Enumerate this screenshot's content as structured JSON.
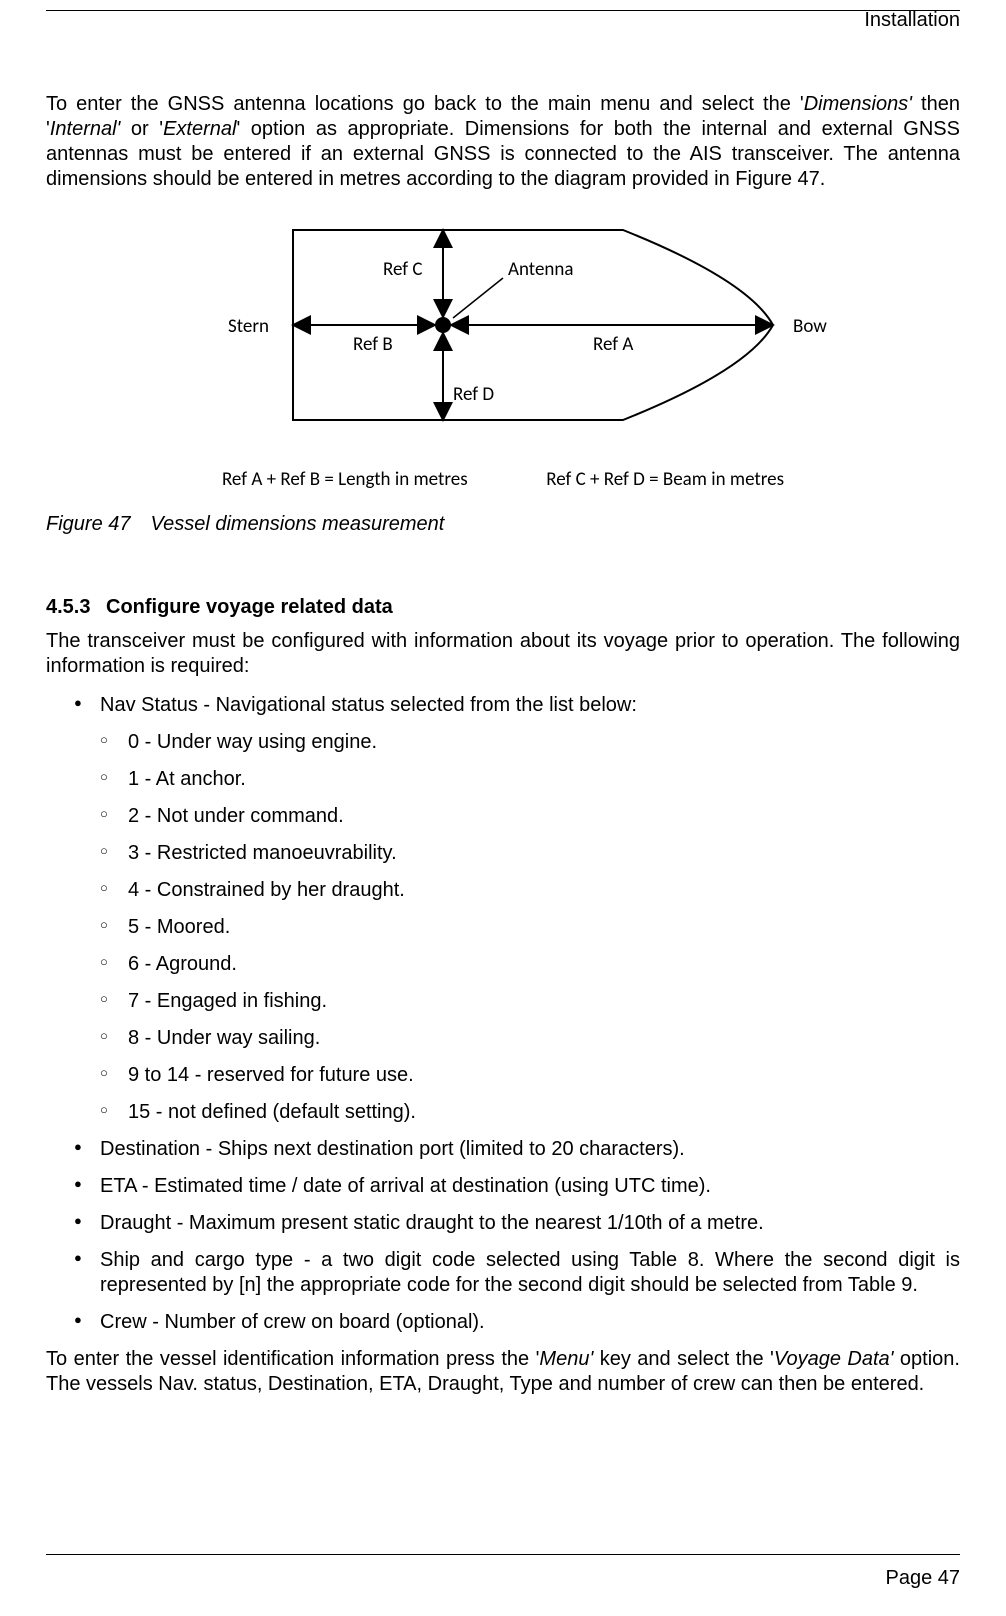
{
  "runningHead": "Installation",
  "pageNumber": "Page 47",
  "intro": {
    "part1": "To enter the GNSS antenna locations go back to the main menu and select the '",
    "dimWord": "Dimensions'",
    "part2": " then '",
    "intWord": "Internal'",
    "part3": " or '",
    "extWord": "External",
    "part4": "' option as appropriate. Dimensions for both the internal and external GNSS antennas must be entered if an external GNSS is connected to the AIS transceiver. The antenna dimensions should be entered in metres according to the diagram provided in Figure 47."
  },
  "figure": {
    "stern": "Stern",
    "bow": "Bow",
    "antenna": "Antenna",
    "refA": "Ref A",
    "refB": "Ref B",
    "refC": "Ref C",
    "refD": "Ref D",
    "eq1": "Ref A + Ref B = Length in metres",
    "eq2": "Ref C + Ref D = Beam in metres",
    "caption": "Figure 47 Vessel dimensions measurement"
  },
  "section": {
    "number": "4.5.3",
    "title": "Configure voyage related data",
    "lead": "The transceiver must be configured with information about its voyage prior to operation. The following information is required:"
  },
  "bullets": {
    "navStatus": "Nav Status - Navigational status selected from the list below:",
    "navItems": [
      "0 - Under way using engine.",
      "1 - At anchor.",
      "2 - Not under command.",
      "3 - Restricted manoeuvrability.",
      "4 - Constrained by her draught.",
      "5 - Moored.",
      "6 - Aground.",
      "7 - Engaged in fishing.",
      "8 - Under way sailing.",
      "9 to 14 - reserved for future use.",
      "15 - not defined (default setting)."
    ],
    "destination": "Destination - Ships next destination port (limited to 20 characters).",
    "eta": "ETA - Estimated time / date of arrival at destination (using UTC time).",
    "draught": "Draught - Maximum present static draught to the nearest 1/10th of a metre.",
    "shipCargo": "Ship and cargo type - a two digit code selected using Table 8. Where the second digit is represented by [n] the appropriate code for the second digit should be selected from Table 9.",
    "crew": "Crew - Number of crew on board (optional)."
  },
  "closing": {
    "part1": "To enter the vessel identification information press the '",
    "menuWord": "Menu'",
    "part2": " key and select the '",
    "voyageWord": "Voyage Data'",
    "part3": " option. The vessels Nav. status, Destination, ETA, Draught, Type and number of crew can then be entered."
  }
}
